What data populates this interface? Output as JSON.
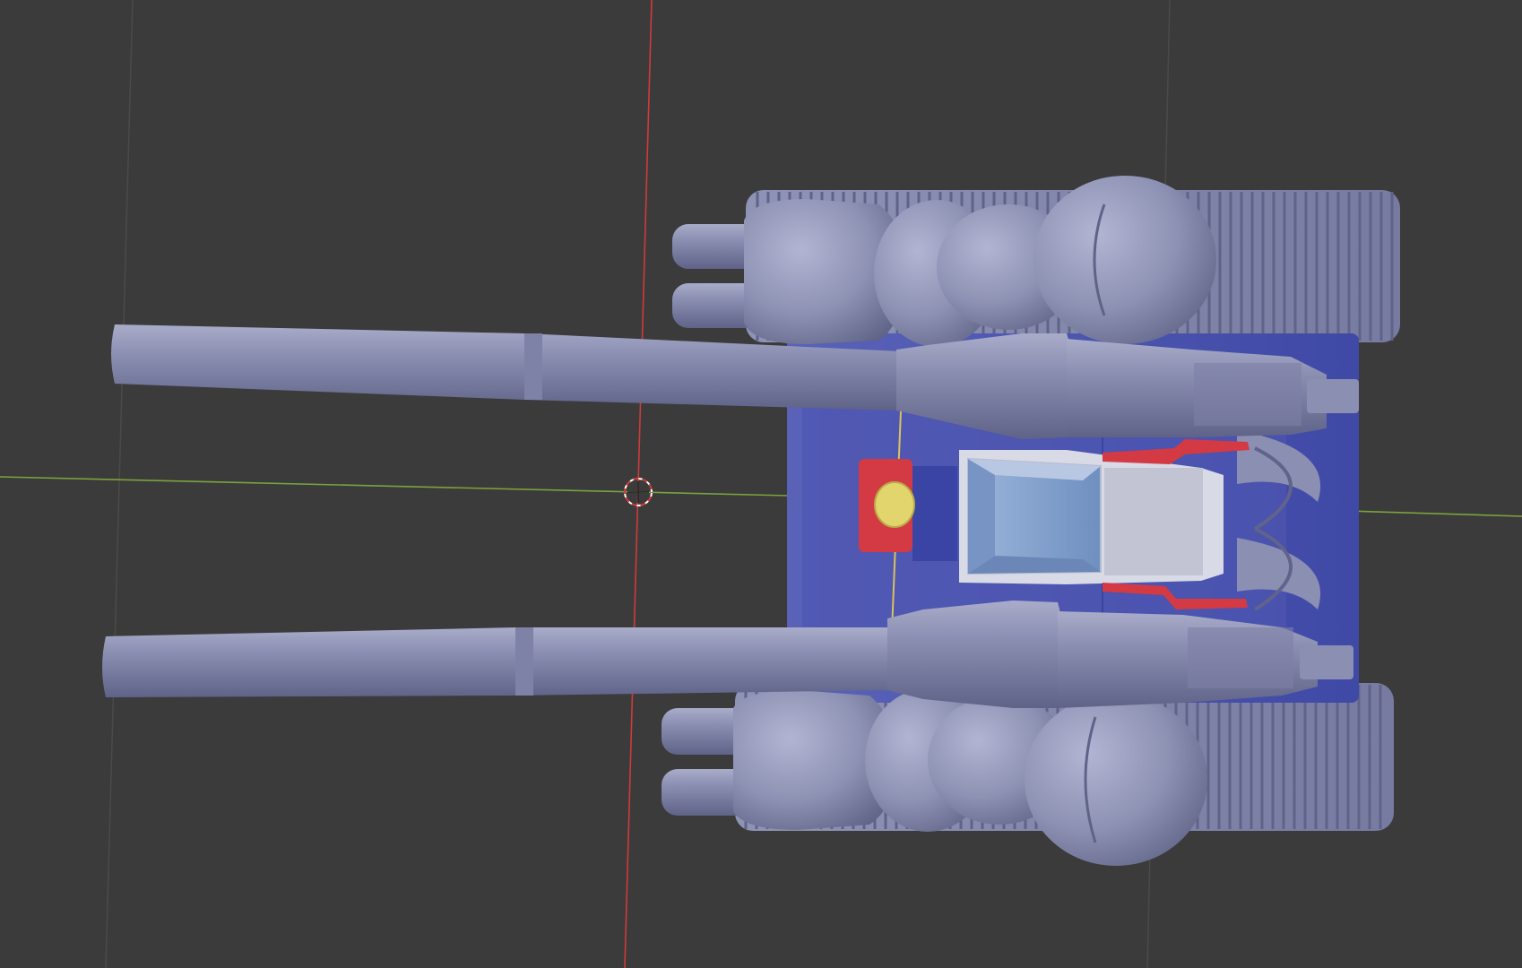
{
  "app": {
    "name": "3D Viewport",
    "view": "top-orthographic-like"
  },
  "viewport": {
    "background": "#3b3b3b",
    "grid_line_color": "#4a4a4a",
    "axis_x_color": "#cf3b3b",
    "axis_y_color": "#6fa035"
  },
  "model": {
    "name": "tank",
    "colors": {
      "metal": "#8f93b6",
      "metal_dark": "#6e7396",
      "hull_blue": "#3f49a6",
      "hull_blue_light": "#5a62b8",
      "accent_red": "#d33a44",
      "glass": "#8aa6cf",
      "cockpit_white": "#d8dae6",
      "light_yellow": "#e2d56d"
    }
  },
  "cursor": {
    "name": "3d-cursor"
  }
}
